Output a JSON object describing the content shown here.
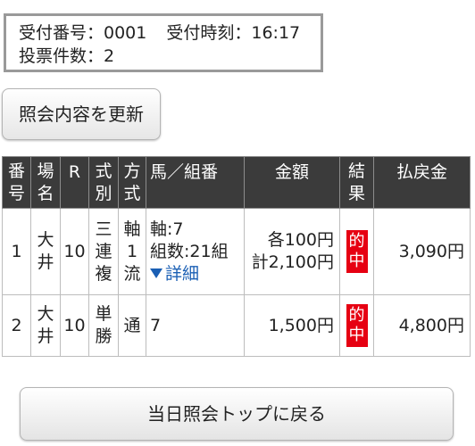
{
  "info": {
    "receipt_no_label": "受付番号：0001",
    "receipt_time_label": "受付時刻：16:17",
    "ticket_count_label": "投票件数：2"
  },
  "refresh_button": {
    "label": "照会内容を更新"
  },
  "table": {
    "headers": {
      "no": "番号",
      "venue": "場名",
      "race": "R",
      "type": "式別",
      "method": "方式",
      "combo": "馬／組番",
      "amount": "金額",
      "result": "結果",
      "payout": "払戻金"
    },
    "rows": [
      {
        "no": "1",
        "venue": "大井",
        "race": "10",
        "type": "三連複",
        "method": "軸1流",
        "combo_line1": "軸:7",
        "combo_line2": "組数:21組",
        "detail_link": "詳細",
        "amount_line1": "各100円",
        "amount_line2": "計2,100円",
        "result": "的中",
        "payout": "3,090円"
      },
      {
        "no": "2",
        "venue": "大井",
        "race": "10",
        "type": "単勝",
        "method": "通",
        "combo_line1": "7",
        "amount_line1": "1,500円",
        "result": "的中",
        "payout": "4,800円"
      }
    ]
  },
  "back_button": {
    "label": "当日照会トップに戻る"
  },
  "colors": {
    "header_bg": "#3b3b3b",
    "hit_badge": "#e60012",
    "link": "#1a5fb4"
  },
  "icons": {
    "detail_toggle": "triangle-down-icon"
  }
}
